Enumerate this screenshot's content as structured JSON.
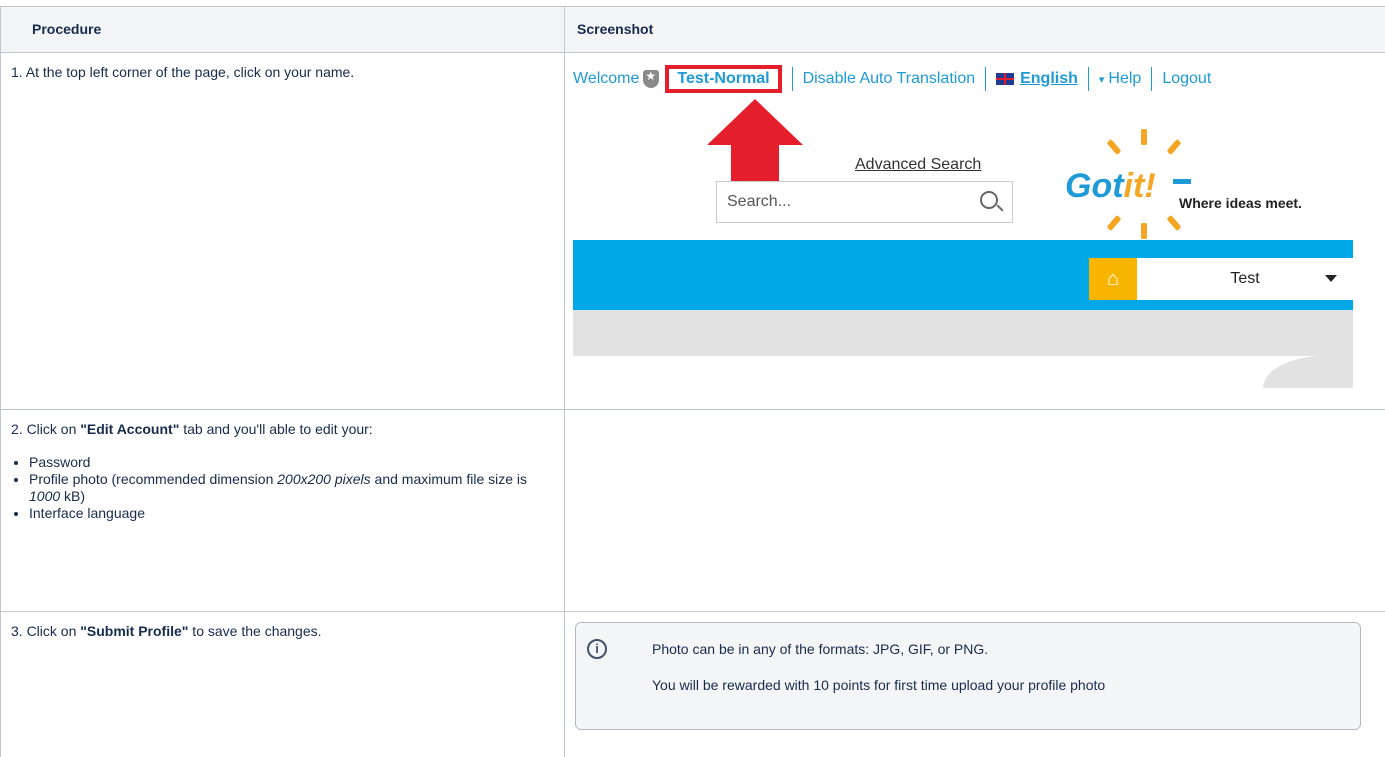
{
  "table": {
    "headers": [
      "Procedure",
      "Screenshot"
    ],
    "rows": [
      {
        "step": "1. At the top left corner of the page, click on your name."
      },
      {
        "step_prefix": "2. Click on ",
        "step_bold": "\"Edit Account\"",
        "step_suffix": " tab and you'll able to edit your:",
        "items": {
          "password": "Password",
          "photo_a": "Profile photo (recommended dimension ",
          "photo_dim": "200x200 pixels",
          "photo_b": " and maximum file size is ",
          "photo_size": "1000",
          "photo_c": " kB)",
          "language": "Interface language"
        }
      },
      {
        "step_prefix": "3. Click on ",
        "step_bold": "\"Submit Profile\"",
        "step_suffix": " to save the changes."
      }
    ]
  },
  "mock": {
    "welcome": "Welcome",
    "user_name": "Test-Normal",
    "disable_translation": "Disable Auto Translation",
    "language": "English",
    "help": "Help",
    "logout": "Logout",
    "advanced_search": "Advanced Search",
    "search_placeholder": "Search...",
    "logo_got": "Got",
    "logo_it": "it!",
    "logo_tagline": "Where ideas meet.",
    "community_select": "Test"
  },
  "info": {
    "line1": "Photo can be in any of the formats: JPG, GIF, or PNG.",
    "line2": "You will be rewarded with 10 points for first time upload your profile photo"
  },
  "colors": {
    "link_blue": "#1e9ad6",
    "highlight_red": "#e41e2b",
    "nav_blue": "#00a8e8",
    "home_yellow": "#f7b500"
  }
}
